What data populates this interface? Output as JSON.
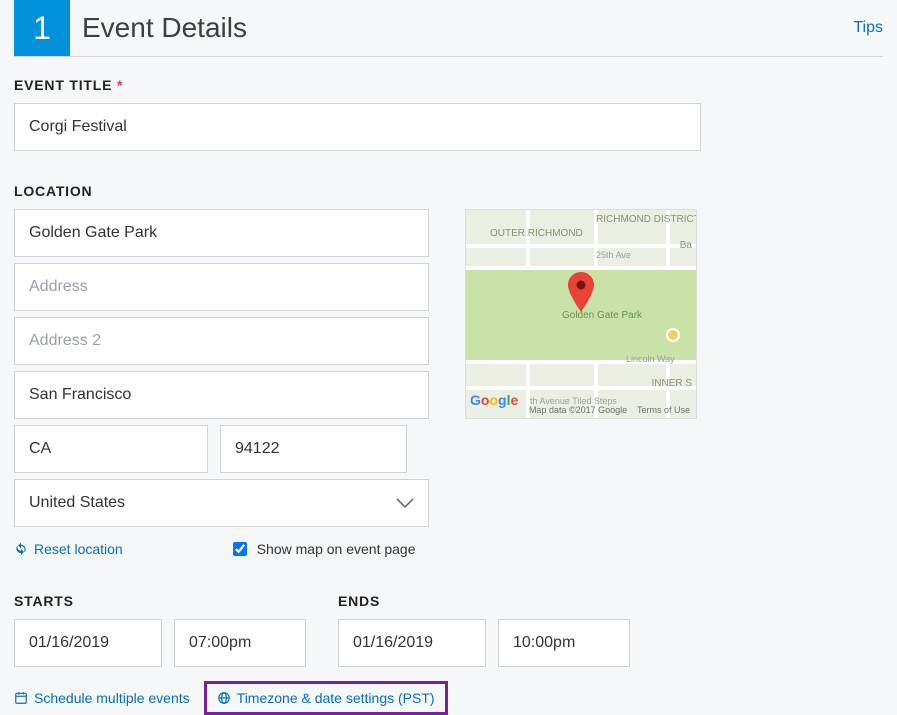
{
  "header": {
    "step_number": "1",
    "title": "Event Details",
    "tips": "Tips"
  },
  "event_title": {
    "label": "EVENT TITLE",
    "required_marker": "*",
    "value": "Corgi Festival"
  },
  "location": {
    "label": "LOCATION",
    "venue": "Golden Gate Park",
    "address_placeholder": "Address",
    "address_value": "",
    "address2_placeholder": "Address 2",
    "address2_value": "",
    "city": "San Francisco",
    "state": "CA",
    "zip": "94122",
    "country": "United States",
    "reset_link": "Reset location",
    "show_map_label": "Show map on event page",
    "show_map_checked": true,
    "map": {
      "labels": {
        "outer_richmond": "OUTER\nRICHMOND",
        "richmond_district": "RICHMOND\nDISTRICT",
        "ba": "Ba",
        "street_25": "25th Ave",
        "golden_gate_park": "Golden\nGate Park",
        "lincoln": "Lincoln Way",
        "inner_s": "INNER S",
        "tiled_steps": "th Avenue Tiled Steps"
      },
      "credit_data": "Map data ©2017 Google",
      "credit_terms": "Terms of Use"
    }
  },
  "starts": {
    "label": "STARTS",
    "date": "01/16/2019",
    "time": "07:00pm"
  },
  "ends": {
    "label": "ENDS",
    "date": "01/16/2019",
    "time": "10:00pm"
  },
  "links": {
    "schedule_multiple": "Schedule multiple events",
    "timezone_settings": "Timezone & date settings (PST)"
  }
}
